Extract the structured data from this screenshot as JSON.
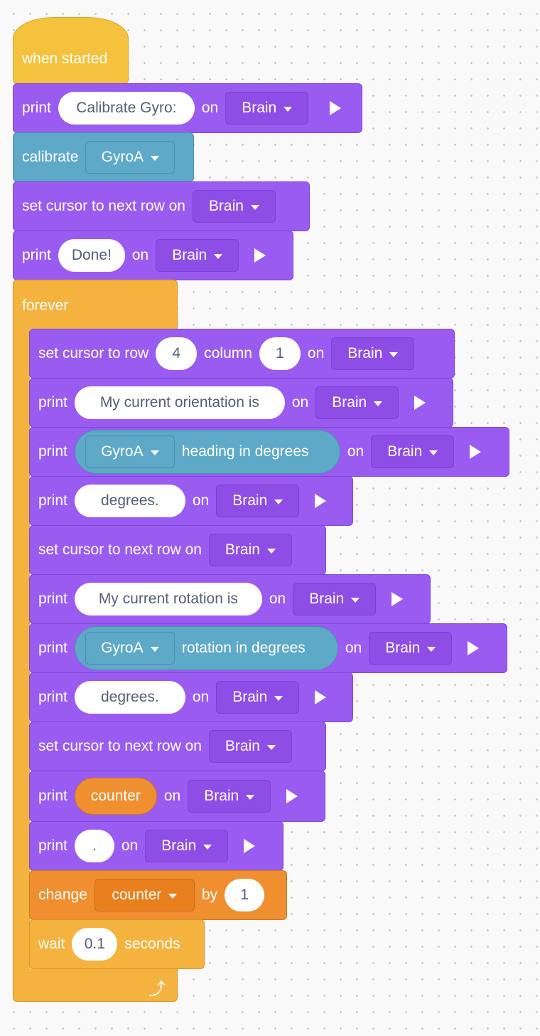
{
  "hat": {
    "label": "when started"
  },
  "blocks": {
    "b1": {
      "verb": "print",
      "text": "Calibrate Gyro:",
      "on": "on",
      "device": "Brain"
    },
    "b2": {
      "verb": "calibrate",
      "sensor": "GyroA"
    },
    "b3": {
      "label": "set cursor to next row on",
      "device": "Brain"
    },
    "b4": {
      "verb": "print",
      "text": "Done!",
      "on": "on",
      "device": "Brain"
    },
    "loop": {
      "label": "forever"
    },
    "b5": {
      "label": "set cursor to row",
      "row": "4",
      "col_label": "column",
      "col": "1",
      "on": "on",
      "device": "Brain"
    },
    "b6": {
      "verb": "print",
      "text": "My current orientation is",
      "on": "on",
      "device": "Brain"
    },
    "b7": {
      "verb": "print",
      "sensor": "GyroA",
      "reporter": "heading in degrees",
      "on": "on",
      "device": "Brain"
    },
    "b8": {
      "verb": "print",
      "text": "degrees.",
      "on": "on",
      "device": "Brain"
    },
    "b9": {
      "label": "set cursor to next row on",
      "device": "Brain"
    },
    "b10": {
      "verb": "print",
      "text": "My current rotation is",
      "on": "on",
      "device": "Brain"
    },
    "b11": {
      "verb": "print",
      "sensor": "GyroA",
      "reporter": "rotation in degrees",
      "on": "on",
      "device": "Brain"
    },
    "b12": {
      "verb": "print",
      "text": "degrees.",
      "on": "on",
      "device": "Brain"
    },
    "b13": {
      "label": "set cursor to next row on",
      "device": "Brain"
    },
    "b14": {
      "verb": "print",
      "variable": "counter",
      "on": "on",
      "device": "Brain"
    },
    "b15": {
      "verb": "print",
      "text": ".",
      "on": "on",
      "device": "Brain"
    },
    "b16": {
      "verb": "change",
      "variable": "counter",
      "by": "by",
      "value": "1"
    },
    "b17": {
      "verb": "wait",
      "value": "0.1",
      "unit": "seconds"
    }
  },
  "colors": {
    "looks_purple": "#9a5cf0",
    "sensing_teal": "#5ea9c8",
    "variable_orange": "#ef8f30",
    "control_yellow": "#f4b23f",
    "event_yellow": "#f4c23d"
  }
}
